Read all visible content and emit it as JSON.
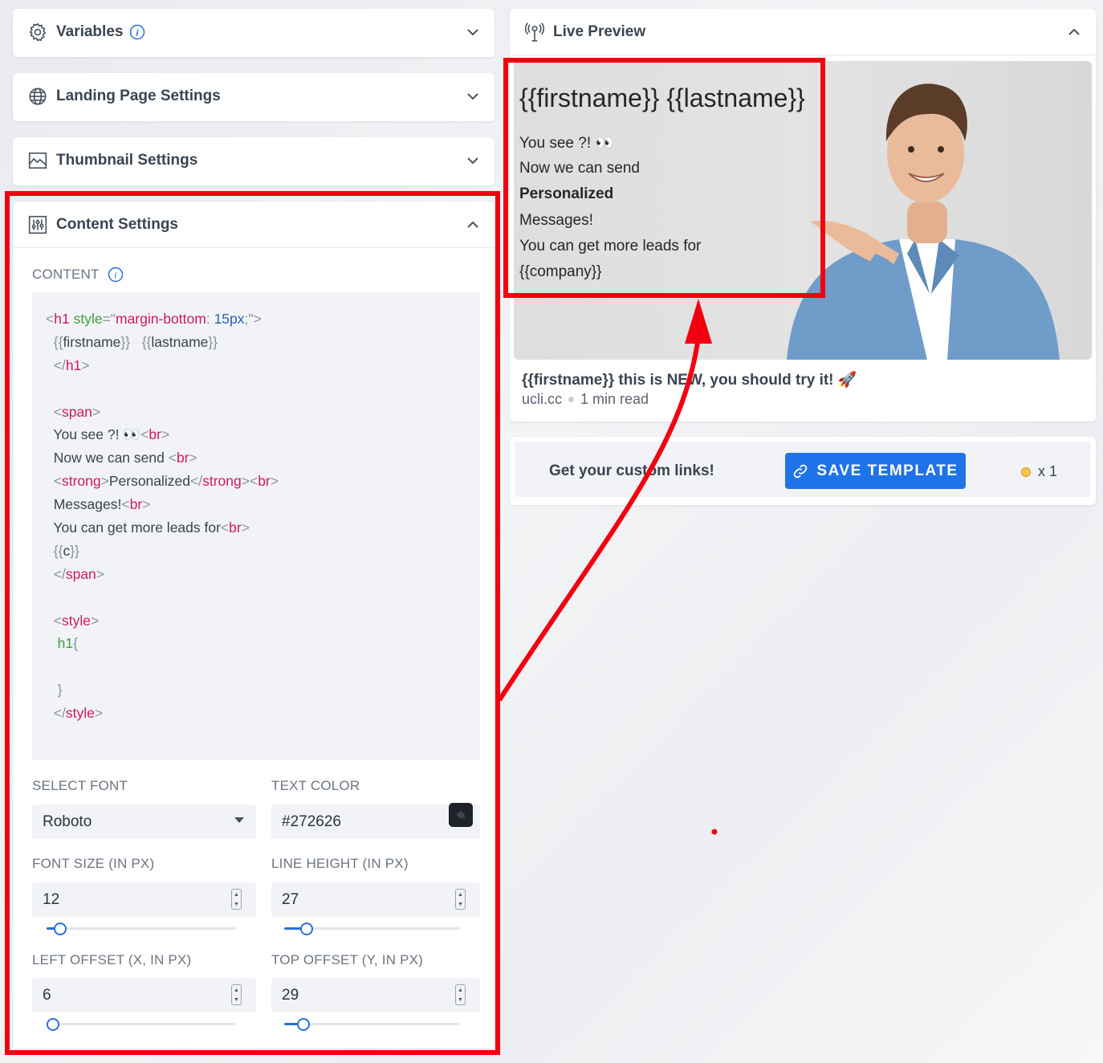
{
  "left": {
    "variables": {
      "title": "Variables"
    },
    "landing": {
      "title": "Landing Page Settings"
    },
    "thumbnail": {
      "title": "Thumbnail Settings"
    },
    "content_settings": {
      "title": "Content Settings",
      "content_label": "CONTENT",
      "code_lines": [
        [
          [
            "punc",
            "<"
          ],
          [
            "tag",
            "h1"
          ],
          [
            "txt",
            " "
          ],
          [
            "attr",
            "style"
          ],
          [
            "punc",
            "=\""
          ],
          [
            "tag",
            "margin-bottom"
          ],
          [
            "punc",
            ": "
          ],
          [
            "num",
            "15px"
          ],
          [
            "punc",
            ";\">"
          ]
        ],
        [
          [
            "txt",
            "  "
          ],
          [
            "punc",
            "{{"
          ],
          [
            "txt",
            "firstname"
          ],
          [
            "punc",
            "}}"
          ],
          [
            "txt",
            "   "
          ],
          [
            "punc",
            "{{"
          ],
          [
            "txt",
            "lastname"
          ],
          [
            "punc",
            "}}"
          ]
        ],
        [
          [
            "txt",
            "  "
          ],
          [
            "punc",
            "</"
          ],
          [
            "tag",
            "h1"
          ],
          [
            "punc",
            ">"
          ]
        ],
        [],
        [
          [
            "txt",
            "  "
          ],
          [
            "punc",
            "<"
          ],
          [
            "tag",
            "span"
          ],
          [
            "punc",
            ">"
          ]
        ],
        [
          [
            "txt",
            "  You see ?! 👀"
          ],
          [
            "punc",
            "<"
          ],
          [
            "tag",
            "br"
          ],
          [
            "punc",
            ">"
          ]
        ],
        [
          [
            "txt",
            "  Now we can send "
          ],
          [
            "punc",
            "<"
          ],
          [
            "tag",
            "br"
          ],
          [
            "punc",
            ">"
          ]
        ],
        [
          [
            "txt",
            "  "
          ],
          [
            "punc",
            "<"
          ],
          [
            "tag",
            "strong"
          ],
          [
            "punc",
            ">"
          ],
          [
            "txt",
            "Personalized"
          ],
          [
            "punc",
            "</"
          ],
          [
            "tag",
            "strong"
          ],
          [
            "punc",
            "><"
          ],
          [
            "tag",
            "br"
          ],
          [
            "punc",
            ">"
          ]
        ],
        [
          [
            "txt",
            "  Messages!"
          ],
          [
            "punc",
            "<"
          ],
          [
            "tag",
            "br"
          ],
          [
            "punc",
            ">"
          ]
        ],
        [
          [
            "txt",
            "  You can get more leads for"
          ],
          [
            "punc",
            "<"
          ],
          [
            "tag",
            "br"
          ],
          [
            "punc",
            ">"
          ]
        ],
        [
          [
            "txt",
            "  "
          ],
          [
            "punc",
            "{{"
          ],
          [
            "txt",
            "c"
          ],
          [
            "punc",
            "}}"
          ]
        ],
        [
          [
            "txt",
            "  "
          ],
          [
            "punc",
            "</"
          ],
          [
            "tag",
            "span"
          ],
          [
            "punc",
            ">"
          ]
        ],
        [],
        [
          [
            "txt",
            "  "
          ],
          [
            "punc",
            "<"
          ],
          [
            "tag",
            "style"
          ],
          [
            "punc",
            ">"
          ]
        ],
        [
          [
            "txt",
            "   "
          ],
          [
            "attr",
            "h1"
          ],
          [
            "punc",
            "{"
          ]
        ],
        [],
        [
          [
            "txt",
            "   "
          ],
          [
            "punc",
            "}"
          ]
        ],
        [
          [
            "txt",
            "  "
          ],
          [
            "punc",
            "</"
          ],
          [
            "tag",
            "style"
          ],
          [
            "punc",
            ">"
          ]
        ]
      ],
      "select_font_label": "SELECT FONT",
      "font_value": "Roboto",
      "text_color_label": "TEXT COLOR",
      "text_color_value": "#272626",
      "font_size_label": "FONT SIZE (IN PX)",
      "font_size_value": "12",
      "font_size_fraction": 0.04,
      "line_height_label": "LINE HEIGHT (IN PX)",
      "line_height_value": "27",
      "line_height_fraction": 0.1,
      "left_offset_label": "LEFT OFFSET (X, IN PX)",
      "left_offset_value": "6",
      "left_offset_fraction": 0.0,
      "top_offset_label": "TOP OFFSET (Y, IN PX)",
      "top_offset_value": "29",
      "top_offset_fraction": 0.08
    }
  },
  "right": {
    "live_preview": {
      "title": "Live Preview"
    },
    "overlay": {
      "heading": "{{firstname}} {{lastname}}",
      "line1": "You see ?! 👀",
      "line2": "Now we can send",
      "line3": "Personalized",
      "line4": "Messages!",
      "line5": "You can get more leads for",
      "line6": "{{company}}"
    },
    "post_title": "{{firstname}} this is NEW, you should try it! 🚀",
    "post_domain": "ucli.cc",
    "post_read": "1 min read",
    "cta_text": "Get your custom links!",
    "save_button": "SAVE TEMPLATE",
    "credits": "x 1"
  },
  "colors": {
    "accent": "#2b6fd6",
    "annotation_red": "#f20010",
    "text_color": "#272626"
  }
}
